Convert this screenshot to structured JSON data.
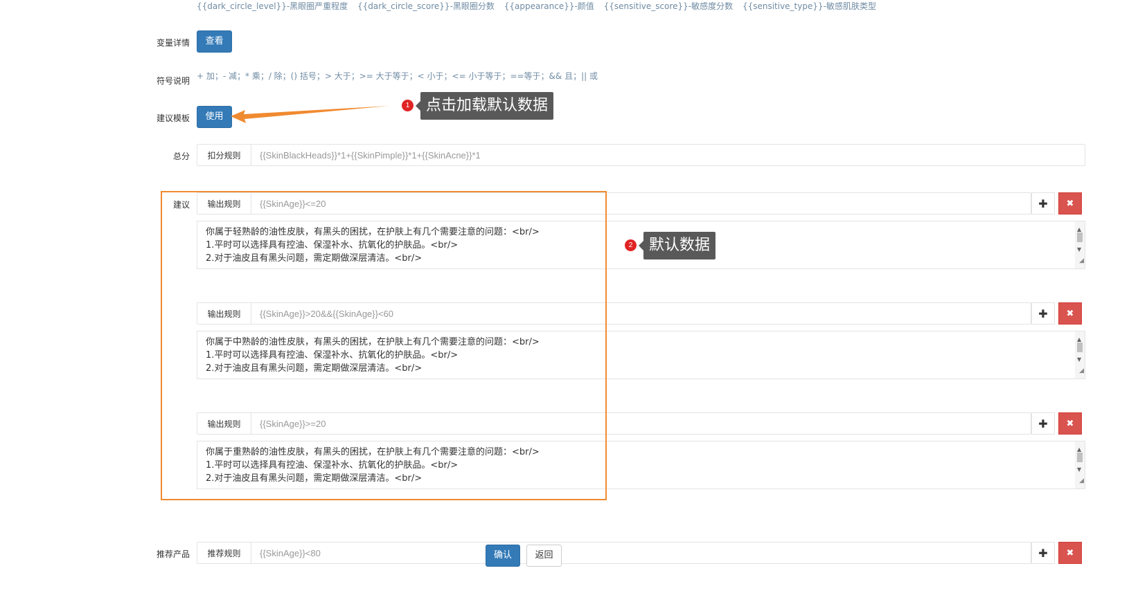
{
  "variables_line": [
    "{{dark_circle_level}}-黑眼圈严重程度",
    "{{dark_circle_score}}-黑眼圈分数",
    "{{appearance}}-颜值",
    "{{sensitive_score}}-敏感度分数",
    "{{sensitive_type}}-敏感肌肤类型"
  ],
  "var_detail": {
    "label": "变量详情",
    "button": "查看"
  },
  "symbols": {
    "label": "符号说明",
    "text": "+ 加；- 减；* 乘；/ 除；() 括号；> 大于；>= 大于等于；< 小于；<= 小于等于；==等于；&& 且；|| 或"
  },
  "template": {
    "label": "建议模板",
    "button": "使用"
  },
  "total": {
    "label": "总分",
    "addon": "扣分规则",
    "value": "{{SkinBlackHeads}}*1+{{SkinPimple}}*1+{{SkinAcne}}*1"
  },
  "advice": {
    "label": "建议",
    "rules": [
      {
        "addon": "输出规则",
        "value": "{{SkinAge}}<=20",
        "lines": [
          "你属于轻熟龄的油性皮肤，有黑头的困扰，在护肤上有几个需要注意的问题：<br/>",
          "1.平时可以选择具有控油、保湿补水、抗氧化的护肤品。<br/>",
          "2.对于油皮且有黑头问题，需定期做深层清洁。<br/>"
        ]
      },
      {
        "addon": "输出规则",
        "value": "{{SkinAge}}>20&&{{SkinAge}}<60",
        "lines": [
          "你属于中熟龄的油性皮肤，有黑头的困扰，在护肤上有几个需要注意的问题：<br/>",
          "1.平时可以选择具有控油、保湿补水、抗氧化的护肤品。<br/>",
          "2.对于油皮且有黑头问题，需定期做深层清洁。<br/>"
        ]
      },
      {
        "addon": "输出规则",
        "value": "{{SkinAge}}>=20",
        "lines": [
          "你属于重熟龄的油性皮肤，有黑头的困扰，在护肤上有几个需要注意的问题：<br/>",
          "1.平时可以选择具有控油、保湿补水、抗氧化的护肤品。<br/>",
          "2.对于油皮且有黑头问题，需定期做深层清洁。<br/>"
        ]
      }
    ]
  },
  "recommend": {
    "label": "推荐产品",
    "addon": "推荐规则",
    "value": "{{SkinAge}}<80"
  },
  "footer": {
    "confirm": "确认",
    "back": "返回"
  },
  "annotations": {
    "tip1": {
      "badge": "1",
      "text": "点击加载默认数据"
    },
    "tip2": {
      "badge": "2",
      "text": "默认数据"
    }
  },
  "icons": {
    "add": "plus-icon",
    "delete": "close-icon"
  }
}
